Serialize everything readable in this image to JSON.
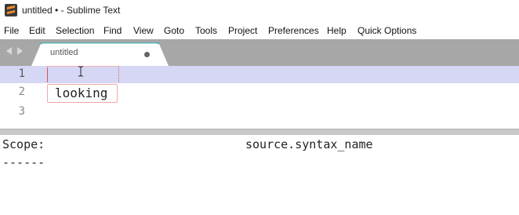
{
  "window": {
    "title": "untitled • - Sublime Text",
    "app_icon": "sublime-text-logo"
  },
  "menu": [
    "File",
    "Edit",
    "Selection",
    "Find",
    "View",
    "Goto",
    "Tools",
    "Project",
    "Preferences",
    "Help",
    "Quick Options"
  ],
  "tabs": [
    {
      "label": "untitled",
      "dirty": true,
      "active": true
    }
  ],
  "editor": {
    "lines": [
      {
        "number": "1",
        "text": ""
      },
      {
        "number": "2",
        "text": "looking"
      },
      {
        "number": "3",
        "text": ""
      }
    ],
    "active_line": "1"
  },
  "output": {
    "scope_label": "Scope:",
    "scope_value": "source.syntax_name",
    "separator": "------"
  },
  "colors": {
    "tab_strip": "#a7a7a7",
    "active_line": "#d6d6f5",
    "tab_accent": "#5fb3b3"
  }
}
